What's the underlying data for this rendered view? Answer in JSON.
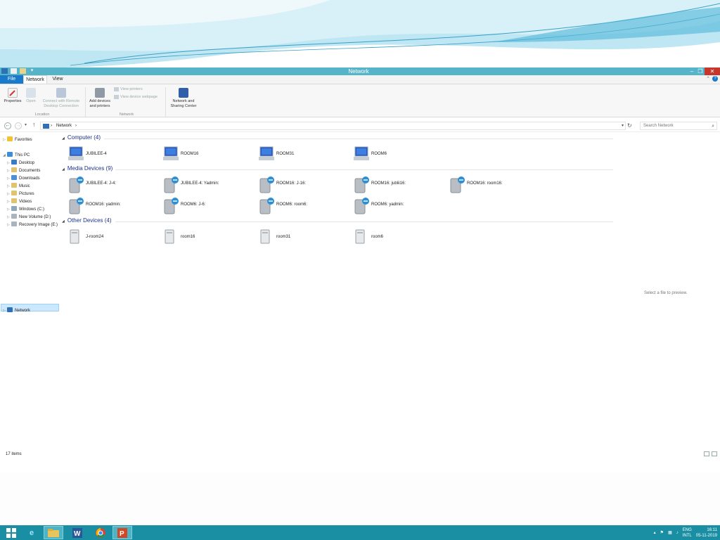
{
  "window": {
    "title": "Network"
  },
  "ribbon_tabs": {
    "file": "File",
    "network": "Network",
    "view": "View"
  },
  "ribbon": {
    "properties": "Properties",
    "open": "Open",
    "connect_line1": "Connect with Remote",
    "connect_line2": "Desktop Connection",
    "group_location": "Location",
    "add_devices_line1": "Add devices",
    "add_devices_line2": "and printers",
    "view_printers": "View printers",
    "view_device_webpage": "View device webpage",
    "group_network": "Network",
    "nsc_line1": "Network and",
    "nsc_line2": "Sharing Center"
  },
  "address": {
    "path": "Network",
    "search_placeholder": "Search Network"
  },
  "nav": {
    "favorites": "Favorites",
    "this_pc": "This PC",
    "desktop": "Desktop",
    "documents": "Documents",
    "downloads": "Downloads",
    "music": "Music",
    "pictures": "Pictures",
    "videos": "Videos",
    "windows_c": "Windows  (C:)",
    "new_volume": "New Volume (D:)",
    "recovery": "Recovery Image (E:)",
    "network": "Network"
  },
  "groups": {
    "computer": {
      "header": "Computer (4)",
      "items": [
        "JUBILEE-4",
        "ROOM16",
        "ROOM31",
        "ROOM6"
      ]
    },
    "media": {
      "header": "Media Devices (9)",
      "items": [
        "JUBILEE-4: J-4:",
        "JUBILEE-4: Yadmin:",
        "ROOM16: J-16:",
        "ROOM16: jublii16:",
        "ROOM16: room16:",
        "ROOM16: yadmin:",
        "ROOM6: J-6:",
        "ROOM6: room6:",
        "ROOM6: yadmin:"
      ]
    },
    "other": {
      "header": "Other Devices (4)",
      "items": [
        "J-room24",
        "room16",
        "room31",
        "room6"
      ]
    }
  },
  "preview_text": "Select a file to preview.",
  "status": {
    "item_count": "17 items"
  },
  "taskbar": {
    "lang1": "ENG",
    "lang2": "INTL",
    "time": "16:11",
    "date": "05-11-2019",
    "apps": [
      "start-icon",
      "internet-explorer-icon",
      "file-explorer-icon",
      "word-icon",
      "chrome-icon",
      "powerpoint-icon"
    ]
  },
  "colors": {
    "titlebar": "#56b4c9",
    "taskbar": "#1a8ea3",
    "file_tab": "#1979ca",
    "group_header": "#1e3287",
    "selection": "#cce8ff"
  }
}
